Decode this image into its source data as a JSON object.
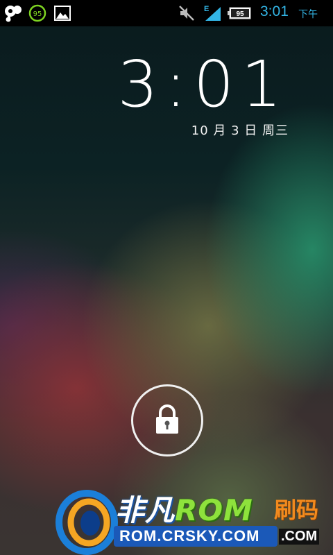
{
  "status_bar": {
    "left_icons": [
      "music-app-icon",
      "battery-percent-circle-icon",
      "gallery-notification-icon"
    ],
    "battery_circle_value": "95",
    "signal_network_type": "E",
    "battery_level": "95",
    "time": "3:01",
    "ampm": "下午",
    "accent_color": "#33b5e5"
  },
  "lockscreen": {
    "clock": "3:01",
    "date": "10 月 3 日 周三",
    "unlock_icon": "lock-icon"
  },
  "watermark": {
    "title_cn": "非凡",
    "title_rom": "ROM",
    "title_extra": "刷码",
    "url": "ROM.CRSKY.COM",
    "url_suffix": ".COM"
  }
}
